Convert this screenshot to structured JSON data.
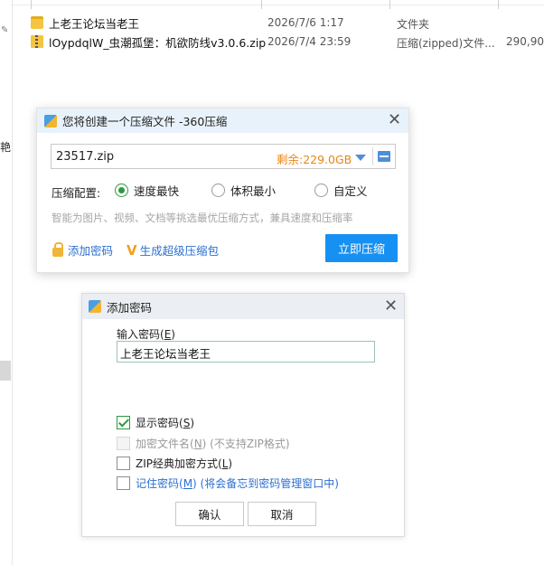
{
  "explorer": {
    "left_char": "艳",
    "pin_glyph": "✎",
    "files": [
      {
        "name": "上老王论坛当老王",
        "date": "2026/7/6 1:17",
        "type": "文件夹",
        "size": "",
        "icon": "folder-icon"
      },
      {
        "name": "lOypdqlW_虫潮孤堡：机欲防线v3.0.6.zip",
        "date": "2026/7/4 23:59",
        "type": "压缩(zipped)文件...",
        "size": "290,90",
        "icon": "zip-icon"
      }
    ]
  },
  "compress_dialog": {
    "title": "您将创建一个压缩文件 -360压缩",
    "close_glyph": "✕",
    "path_value": "23517.zip",
    "free_space": "剩余:229.0GB",
    "config_label": "压缩配置:",
    "options": [
      {
        "label": "速度最快",
        "selected": true
      },
      {
        "label": "体积最小",
        "selected": false
      },
      {
        "label": "自定义",
        "selected": false
      }
    ],
    "hint": "智能为图片、视频、文档等挑选最优压缩方式，兼具速度和压缩率",
    "add_password_link": "添加密码",
    "super_compress_link": "生成超级压缩包",
    "super_glyph": "V",
    "compress_button": "立即压缩"
  },
  "password_dialog": {
    "title": "添加密码",
    "close_glyph": "✕",
    "input_label": "输入密码(",
    "input_label_key": "E",
    "input_label_end": ")",
    "password_value": "上老王论坛当老王",
    "show_password": {
      "label": "显示密码(",
      "key": "S",
      "end": ")",
      "checked": true
    },
    "encrypt_filenames": {
      "label": "加密文件名(",
      "key": "N",
      "end": ") (不支持ZIP格式)",
      "checked": false,
      "disabled": true
    },
    "zip_classic": {
      "label": "ZIP经典加密方式(",
      "key": "L",
      "end": ")",
      "checked": false
    },
    "remember_password": {
      "label": "记住密码(",
      "key": "M",
      "end": ") (将会备忘到密码管理窗口中)",
      "checked": false
    },
    "ok_button": "确认",
    "cancel_button": "取消"
  },
  "colors": {
    "accent_blue": "#1690f2",
    "link_blue": "#2b6fd0",
    "free_space_orange": "#e8861a",
    "check_green": "#2c9a3e"
  }
}
